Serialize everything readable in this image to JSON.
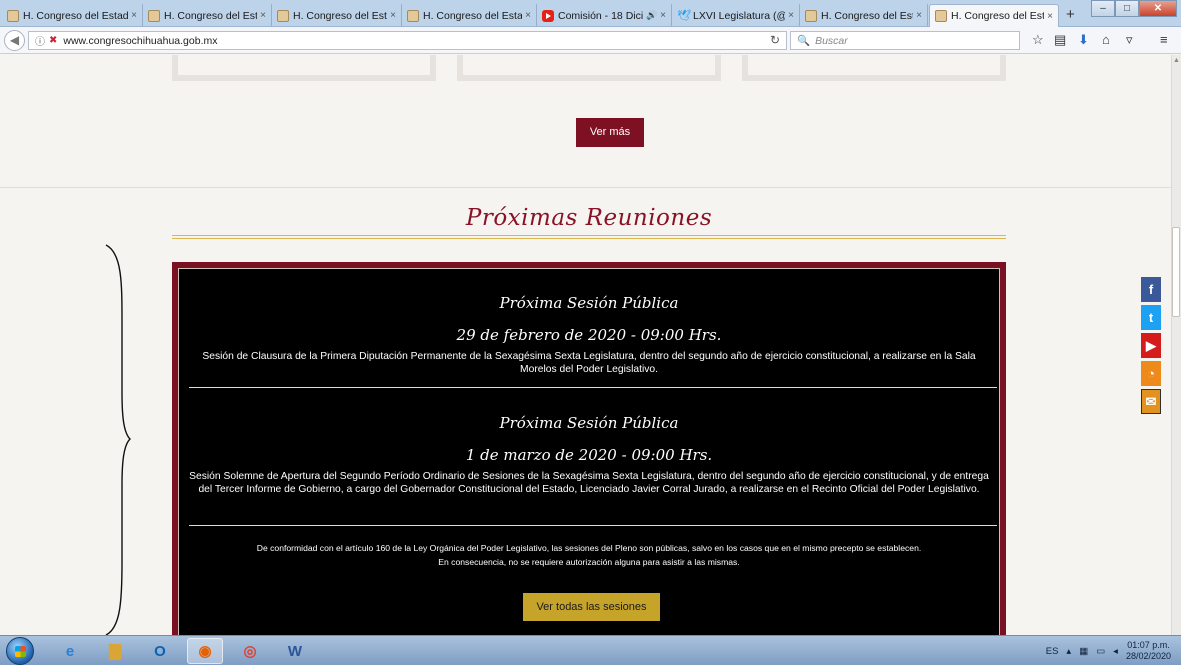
{
  "browser": {
    "tabs": [
      {
        "title": "H. Congreso del Estad",
        "favicon": "crest-icon"
      },
      {
        "title": "H. Congreso del Estad",
        "favicon": "crest-icon"
      },
      {
        "title": "H. Congreso del Estad",
        "favicon": "crest-icon"
      },
      {
        "title": "H. Congreso del Estad",
        "favicon": "crest-icon"
      },
      {
        "title": "Comisión - 18 Dici",
        "favicon": "youtube-icon",
        "audio": "🔊"
      },
      {
        "title": "LXVI Legislatura (@Co",
        "favicon": "twitter-icon"
      },
      {
        "title": "H. Congreso del Estad",
        "favicon": "crest-icon"
      },
      {
        "title": "H. Congreso del Estad",
        "favicon": "crest-icon",
        "active": true
      }
    ],
    "tab_close": "×",
    "new_tab": "+",
    "url": "www.congresochihuahua.gob.mx",
    "search_placeholder": "Buscar",
    "window_controls": {
      "minimize": "–",
      "maximize": "□",
      "close": "✕"
    }
  },
  "page": {
    "ver_mas_label": "Ver más",
    "section_title": "Próximas Reuniones",
    "sessions": [
      {
        "title": "Próxima Sesión Pública",
        "date": "29 de febrero de 2020 - 09:00 Hrs.",
        "description": "Sesión de Clausura de la Primera Diputación Permanente de la Sexagésima Sexta Legislatura, dentro del segundo año de ejercicio constitucional, a realizarse en la Sala Morelos del Poder Legislativo."
      },
      {
        "title": "Próxima Sesión Pública",
        "date": "1 de marzo de 2020 - 09:00 Hrs.",
        "description": "Sesión Solemne de Apertura del Segundo Período Ordinario de Sesiones de la Sexagésima Sexta Legislatura, dentro del segundo año de ejercicio constitucional, y de entrega del Tercer Informe de Gobierno, a cargo del Gobernador Constitucional del Estado, Licenciado Javier Corral Jurado, a realizarse en el Recinto Oficial del Poder Legislativo."
      }
    ],
    "notice_line1": "De conformidad con el artículo 160 de la Ley Orgánica del Poder Legislativo, las sesiones del Pleno son públicas, salvo en los casos que en el mismo precepto se establecen.",
    "notice_line2": "En consecuencia, no se requiere autorización alguna para asistir a las mismas.",
    "ver_todas_label": "Ver todas las sesiones",
    "social": [
      {
        "name": "facebook-icon",
        "glyph": "f"
      },
      {
        "name": "twitter-icon",
        "glyph": "t"
      },
      {
        "name": "youtube-icon",
        "glyph": "▶"
      },
      {
        "name": "rss-icon",
        "glyph": "◔"
      },
      {
        "name": "mail-icon",
        "glyph": "✉"
      }
    ]
  },
  "taskbar": {
    "language": "ES",
    "time": "01:07 p.m.",
    "date": "28/02/2020"
  },
  "colors": {
    "brand_maroon": "#7d1123",
    "gold": "#c6a42a"
  }
}
